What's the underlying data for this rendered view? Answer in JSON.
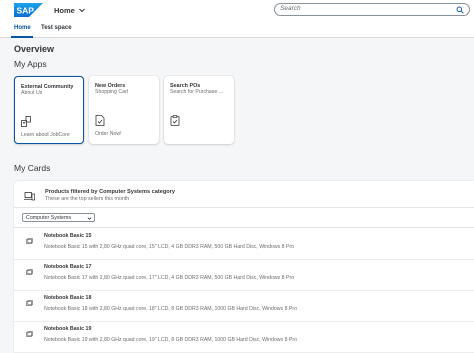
{
  "shell": {
    "logo_text": "SAP",
    "home_label": "Home",
    "search_placeholder": "Search"
  },
  "tabs": [
    {
      "label": "Home",
      "selected": true
    },
    {
      "label": "Test space",
      "selected": false
    }
  ],
  "page": {
    "overview_title": "Overview",
    "apps_title": "My Apps",
    "cards_title": "My Cards"
  },
  "apps": [
    {
      "title": "External Community",
      "subtitle": "About Us",
      "footer": "Learn about JobCore",
      "icon": "community-icon",
      "selected": true
    },
    {
      "title": "New Orders",
      "subtitle": "Shopping Cart",
      "footer": "Order Now!",
      "icon": "order-document-icon",
      "selected": false
    },
    {
      "title": "Search POs",
      "subtitle": "Search for Purchase ...",
      "footer": "",
      "icon": "task-clipboard-icon",
      "selected": false
    }
  ],
  "card": {
    "title": "Products filtered by Computer Systems category",
    "subtitle": "These are the top sellers this month",
    "filter_value": "Computer Systems",
    "items": [
      {
        "name": "Notebook Basic 15",
        "description": "Notebook Basic 15 with 2,80 GHz quad core, 15\" LCD, 4 GB DDR3 RAM, 500 GB Hard Disc, Windows 8 Pro"
      },
      {
        "name": "Notebook Basic 17",
        "description": "Notebook Basic 17 with 2,80 GHz quad core, 17\" LCD, 4 GB DDR3 RAM, 500 GB Hard Disc, Windows 8 Pro"
      },
      {
        "name": "Notebook Basic 18",
        "description": "Notebook Basic 18 with 2,80 GHz quad core, 18\" LCD, 8 GB DDR3 RAM, 1000 GB Hard Disc, Windows 8 Pro"
      },
      {
        "name": "Notebook Basic 19",
        "description": "Notebook Basic 19 with 2,80 GHz quad core, 19\" LCD, 8 GB DDR3 RAM, 1000 GB Hard Disc, Windows 8 Pro"
      }
    ]
  },
  "colors": {
    "brand_blue": "#0a6ed1",
    "selected_blue": "#0854a0",
    "background": "#f5f6f7"
  }
}
